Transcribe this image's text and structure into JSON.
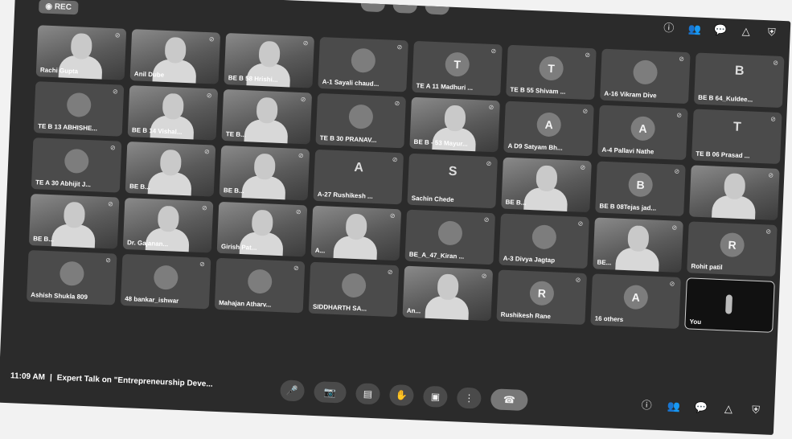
{
  "rec_label": "REC",
  "time": "11:09 AM",
  "separator": "|",
  "meeting_title": "Expert Talk on \"Entrepreneurship Deve...",
  "participants": [
    {
      "name": "Rachi Gupta",
      "type": "video"
    },
    {
      "name": "Anil Dube",
      "type": "video"
    },
    {
      "name": "BE B 58 Hrishi...",
      "type": "video"
    },
    {
      "name": "A-1 Sayali chaud...",
      "type": "avatar",
      "letter": ""
    },
    {
      "name": "TE A 11 Madhuri ...",
      "type": "avatar",
      "letter": "T"
    },
    {
      "name": "TE B 55 Shivam ...",
      "type": "avatar",
      "letter": "T"
    },
    {
      "name": "A-16 Vikram Dive",
      "type": "avatar",
      "letter": ""
    },
    {
      "name": "BE B 64_Kuldee...",
      "type": "letter",
      "letter": "B"
    },
    {
      "name": "TE B 13 ABHISHE...",
      "type": "avatar",
      "letter": ""
    },
    {
      "name": "BE B 14 Vishal...",
      "type": "video"
    },
    {
      "name": "TE B...",
      "type": "video"
    },
    {
      "name": "TE B 30 PRANAV...",
      "type": "avatar",
      "letter": ""
    },
    {
      "name": "BE B - 53 Mayur...",
      "type": "video"
    },
    {
      "name": "A D9 Satyam Bh...",
      "type": "avatar",
      "letter": "A"
    },
    {
      "name": "A-4 Pallavi Nathe",
      "type": "avatar",
      "letter": "A"
    },
    {
      "name": "TE B 06 Prasad ...",
      "type": "letter",
      "letter": "T"
    },
    {
      "name": "TE A 30 Abhijit J...",
      "type": "avatar",
      "letter": ""
    },
    {
      "name": "BE B...",
      "type": "video"
    },
    {
      "name": "BE B...",
      "type": "video"
    },
    {
      "name": "A-27 Rushikesh ...",
      "type": "letter",
      "letter": "A"
    },
    {
      "name": "Sachin Chede",
      "type": "letter",
      "letter": "S"
    },
    {
      "name": "BE B...",
      "type": "video"
    },
    {
      "name": "BE B 08Tejas jad...",
      "type": "avatar",
      "letter": "B"
    },
    {
      "name": "",
      "type": "video"
    },
    {
      "name": "BE B...",
      "type": "video"
    },
    {
      "name": "Dr. Gajanan...",
      "type": "video"
    },
    {
      "name": "Girish Pat...",
      "type": "video"
    },
    {
      "name": "A...",
      "type": "video"
    },
    {
      "name": "BE_A_47_Kiran ...",
      "type": "avatar",
      "letter": ""
    },
    {
      "name": "A-3 Divya Jagtap",
      "type": "avatar",
      "letter": ""
    },
    {
      "name": "BE...",
      "type": "video"
    },
    {
      "name": "Rohit patil",
      "type": "avatar",
      "letter": "R"
    },
    {
      "name": "Ashish Shukla 809",
      "type": "avatar",
      "letter": ""
    },
    {
      "name": "48 bankar_ishwar",
      "type": "avatar",
      "letter": ""
    },
    {
      "name": "Mahajan Atharv...",
      "type": "avatar",
      "letter": ""
    },
    {
      "name": "SIDDHARTH SA...",
      "type": "avatar",
      "letter": ""
    },
    {
      "name": "An...",
      "type": "video"
    },
    {
      "name": "Rushikesh Rane",
      "type": "avatar",
      "letter": "R"
    },
    {
      "name": "16 others",
      "type": "avatar",
      "letter": "A"
    },
    {
      "name": "You",
      "type": "you"
    }
  ],
  "controls": [
    {
      "name": "mic-button",
      "icon": "🎤"
    },
    {
      "name": "camera-button",
      "icon": "📷"
    },
    {
      "name": "captions-button",
      "icon": "▤"
    },
    {
      "name": "raise-hand-button",
      "icon": "✋"
    },
    {
      "name": "present-button",
      "icon": "▣"
    },
    {
      "name": "more-options-button",
      "icon": "⋮"
    },
    {
      "name": "leave-call-button",
      "icon": "☎"
    }
  ],
  "side_icons": [
    "info-icon",
    "people-icon",
    "chat-icon",
    "activities-icon",
    "host-controls-icon"
  ]
}
